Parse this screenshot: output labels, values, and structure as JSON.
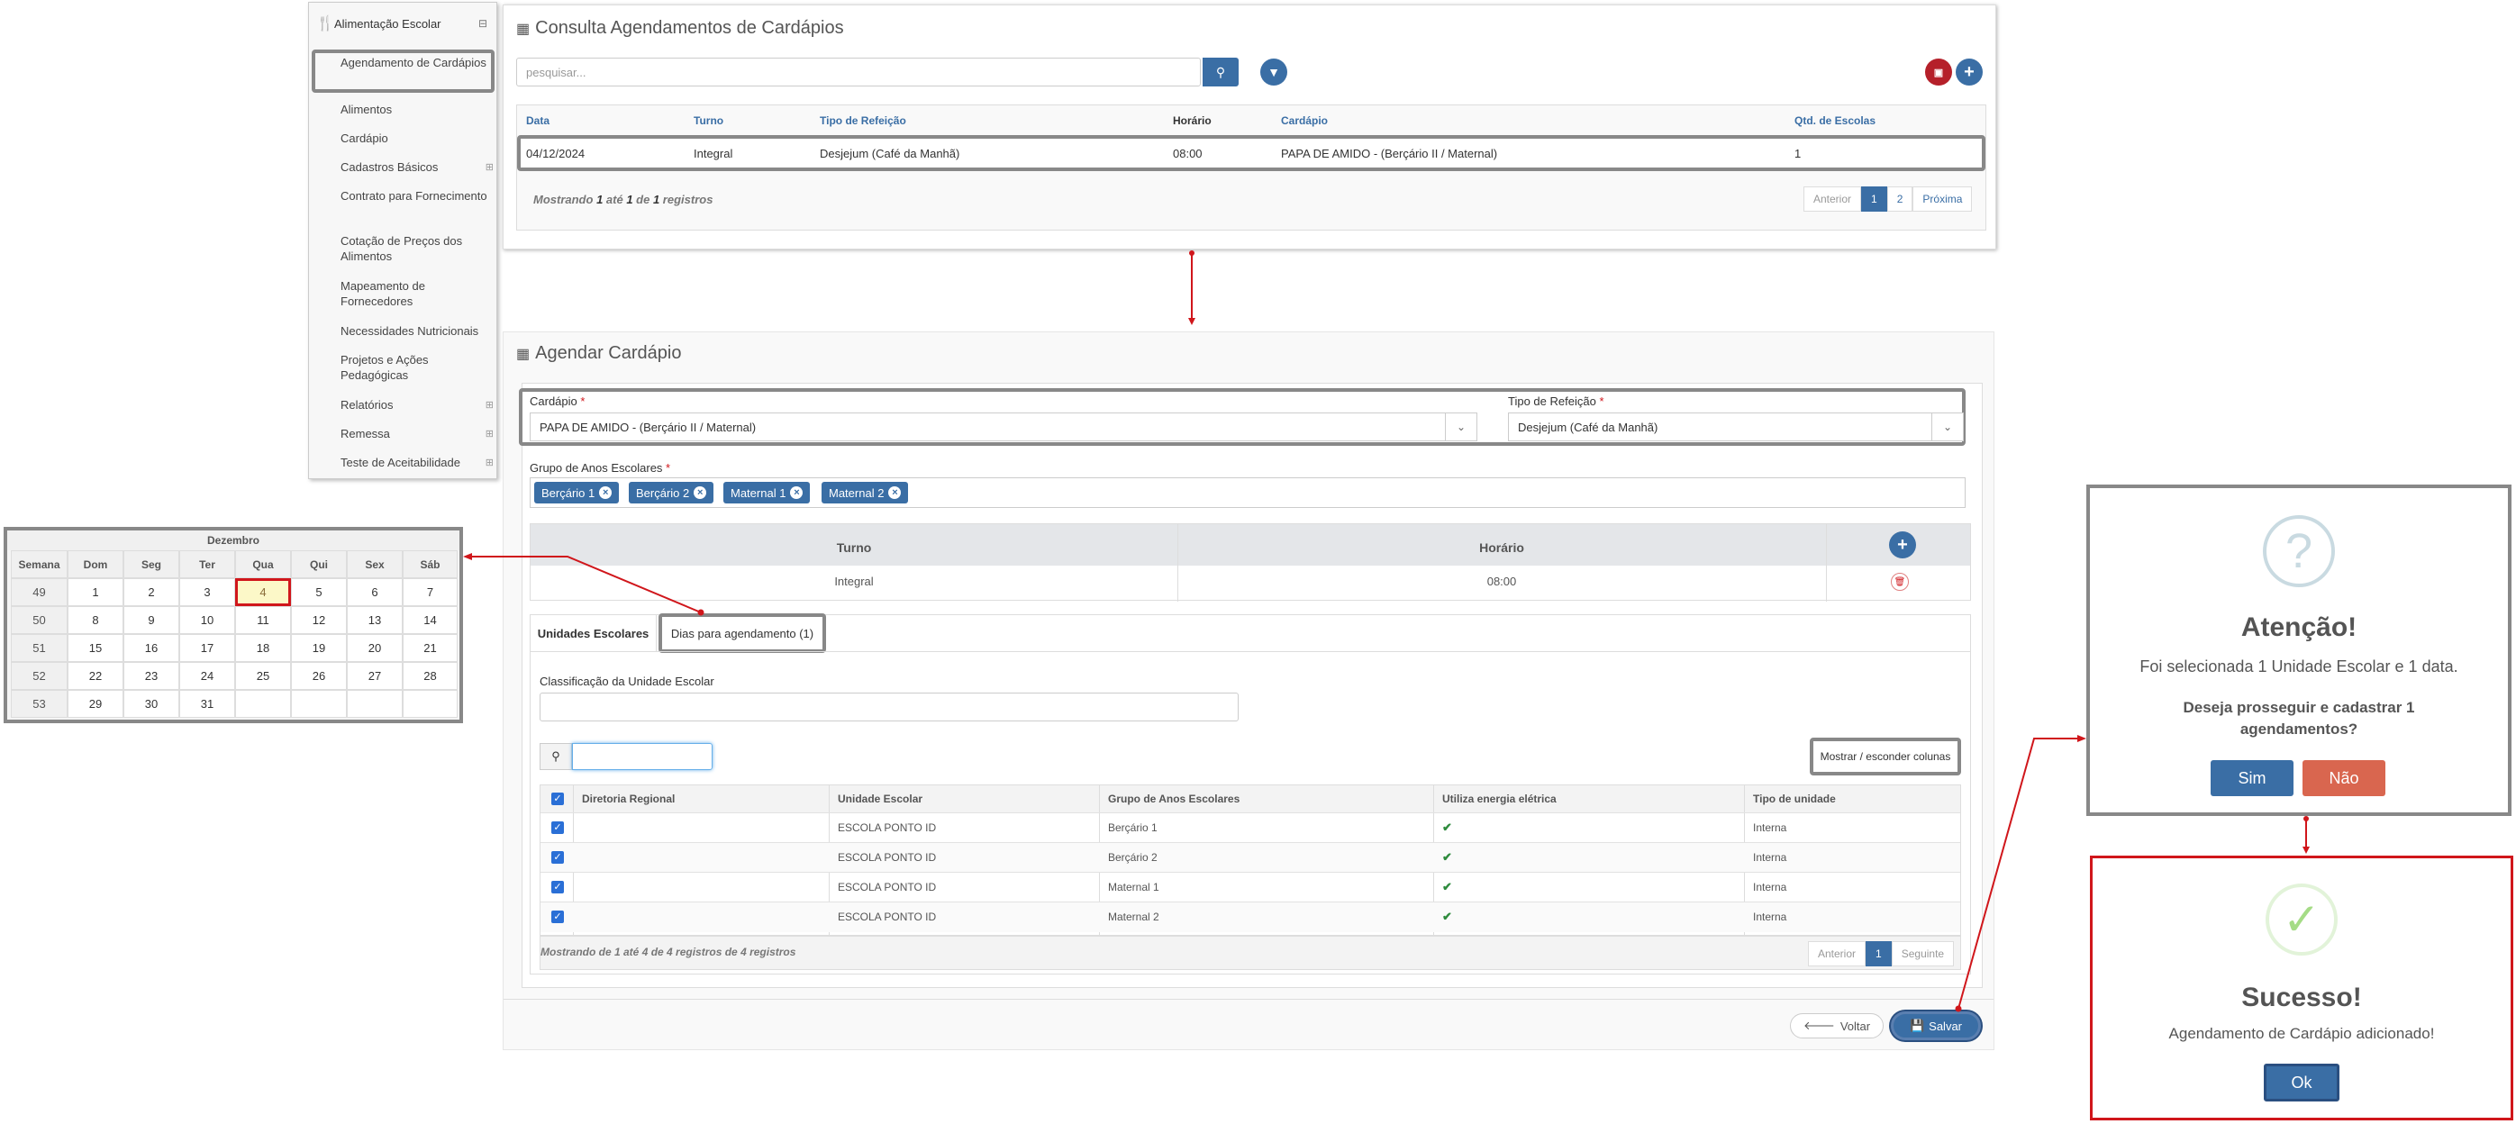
{
  "sidebar": {
    "title": "Alimentação Escolar",
    "toggle": "⊟",
    "items": [
      {
        "label": "Agendamento de Cardápios",
        "expandable": false,
        "selected": true
      },
      {
        "label": "Alimentos",
        "expandable": false
      },
      {
        "label": "Cardápio",
        "expandable": false
      },
      {
        "label": "Cadastros Básicos",
        "expandable": true
      },
      {
        "label": "Contrato para Fornecimento",
        "expandable": false
      },
      {
        "label": "Cotação de Preços dos Alimentos",
        "expandable": false
      },
      {
        "label": "Mapeamento de Fornecedores",
        "expandable": false
      },
      {
        "label": "Necessidades Nutricionais",
        "expandable": false
      },
      {
        "label": "Projetos e Ações Pedagógicas",
        "expandable": false
      },
      {
        "label": "Relatórios",
        "expandable": true
      },
      {
        "label": "Remessa",
        "expandable": true
      },
      {
        "label": "Teste de Aceitabilidade",
        "expandable": true
      }
    ],
    "expand_icon": "⊞"
  },
  "consulta": {
    "title": "Consulta Agendamentos de Cardápios",
    "search_placeholder": "pesquisar...",
    "columns": [
      "Data",
      "Turno",
      "Tipo de Refeição",
      "Horário",
      "Cardápio",
      "Qtd. de Escolas"
    ],
    "row": [
      "04/12/2024",
      "Integral",
      "Desjejum (Café da Manhã)",
      "08:00",
      "PAPA DE AMIDO - (Berçário II / Maternal)",
      "1"
    ],
    "info_prefix": "Mostrando ",
    "info_from": "1",
    "info_mid1": " até ",
    "info_to": "1",
    "info_mid2": " de ",
    "info_total": "1",
    "info_suffix": " registros",
    "pager": {
      "prev": "Anterior",
      "p1": "1",
      "p2": "2",
      "next": "Próxima"
    }
  },
  "agendar": {
    "title": "Agendar Cardápio",
    "cardapio_label": "Cardápio",
    "cardapio_value": "PAPA DE AMIDO - (Berçário II / Maternal)",
    "tipo_label": "Tipo de Refeição",
    "tipo_value": "Desjejum (Café da Manhã)",
    "required_mark": "*",
    "grupo_label": "Grupo de Anos Escolares",
    "tags": [
      "Berçário 1",
      "Berçário 2",
      "Maternal 1",
      "Maternal 2"
    ],
    "turno_header": "Turno",
    "horario_header": "Horário",
    "turno_value": "Integral",
    "horario_value": "08:00",
    "tabs": [
      "Unidades Escolares",
      "Dias para agendamento (1)"
    ],
    "classificacao_label": "Classificação da Unidade Escolar",
    "toggle_columns": "Mostrar / esconder colunas",
    "grid_columns": [
      "Diretoria Regional",
      "Unidade Escolar",
      "Grupo de Anos Escolares",
      "Utiliza energia elétrica",
      "Tipo de unidade"
    ],
    "grid_rows": [
      [
        "",
        "ESCOLA PONTO ID",
        "Berçário 1",
        "✔",
        "Interna"
      ],
      [
        "",
        "ESCOLA PONTO ID",
        "Berçário 2",
        "✔",
        "Interna"
      ],
      [
        "",
        "ESCOLA PONTO ID",
        "Maternal 1",
        "✔",
        "Interna"
      ],
      [
        "",
        "ESCOLA PONTO ID",
        "Maternal 2",
        "✔",
        "Interna"
      ]
    ],
    "grid_info": "Mostrando de 1 até 4 de 4 registros de 4 registros",
    "pager": {
      "prev": "Anterior",
      "p1": "1",
      "next": "Seguinte"
    },
    "voltar": "Voltar",
    "salvar": "Salvar"
  },
  "calendar": {
    "month": "Dezembro",
    "headers": [
      "Semana",
      "Dom",
      "Seg",
      "Ter",
      "Qua",
      "Qui",
      "Sex",
      "Sáb"
    ],
    "weeks": [
      [
        "49",
        "1",
        "2",
        "3",
        "4",
        "5",
        "6",
        "7"
      ],
      [
        "50",
        "8",
        "9",
        "10",
        "11",
        "12",
        "13",
        "14"
      ],
      [
        "51",
        "15",
        "16",
        "17",
        "18",
        "19",
        "20",
        "21"
      ],
      [
        "52",
        "22",
        "23",
        "24",
        "25",
        "26",
        "27",
        "28"
      ],
      [
        "53",
        "29",
        "30",
        "31",
        "",
        "",
        "",
        ""
      ]
    ],
    "selected_day": "4"
  },
  "confirm": {
    "icon": "?",
    "title": "Atenção!",
    "line1": "Foi selecionada 1 Unidade Escolar e 1 data.",
    "line2": "Deseja prosseguir e cadastrar 1 agendamentos?",
    "yes": "Sim",
    "no": "Não"
  },
  "success": {
    "icon": "✓",
    "title": "Sucesso!",
    "message": "Agendamento de Cardápio adicionado!",
    "ok": "Ok"
  },
  "colors": {
    "primary": "#3a6ea5",
    "danger": "#d0161b",
    "no_button": "#d9664f",
    "success": "#a5dc86"
  }
}
